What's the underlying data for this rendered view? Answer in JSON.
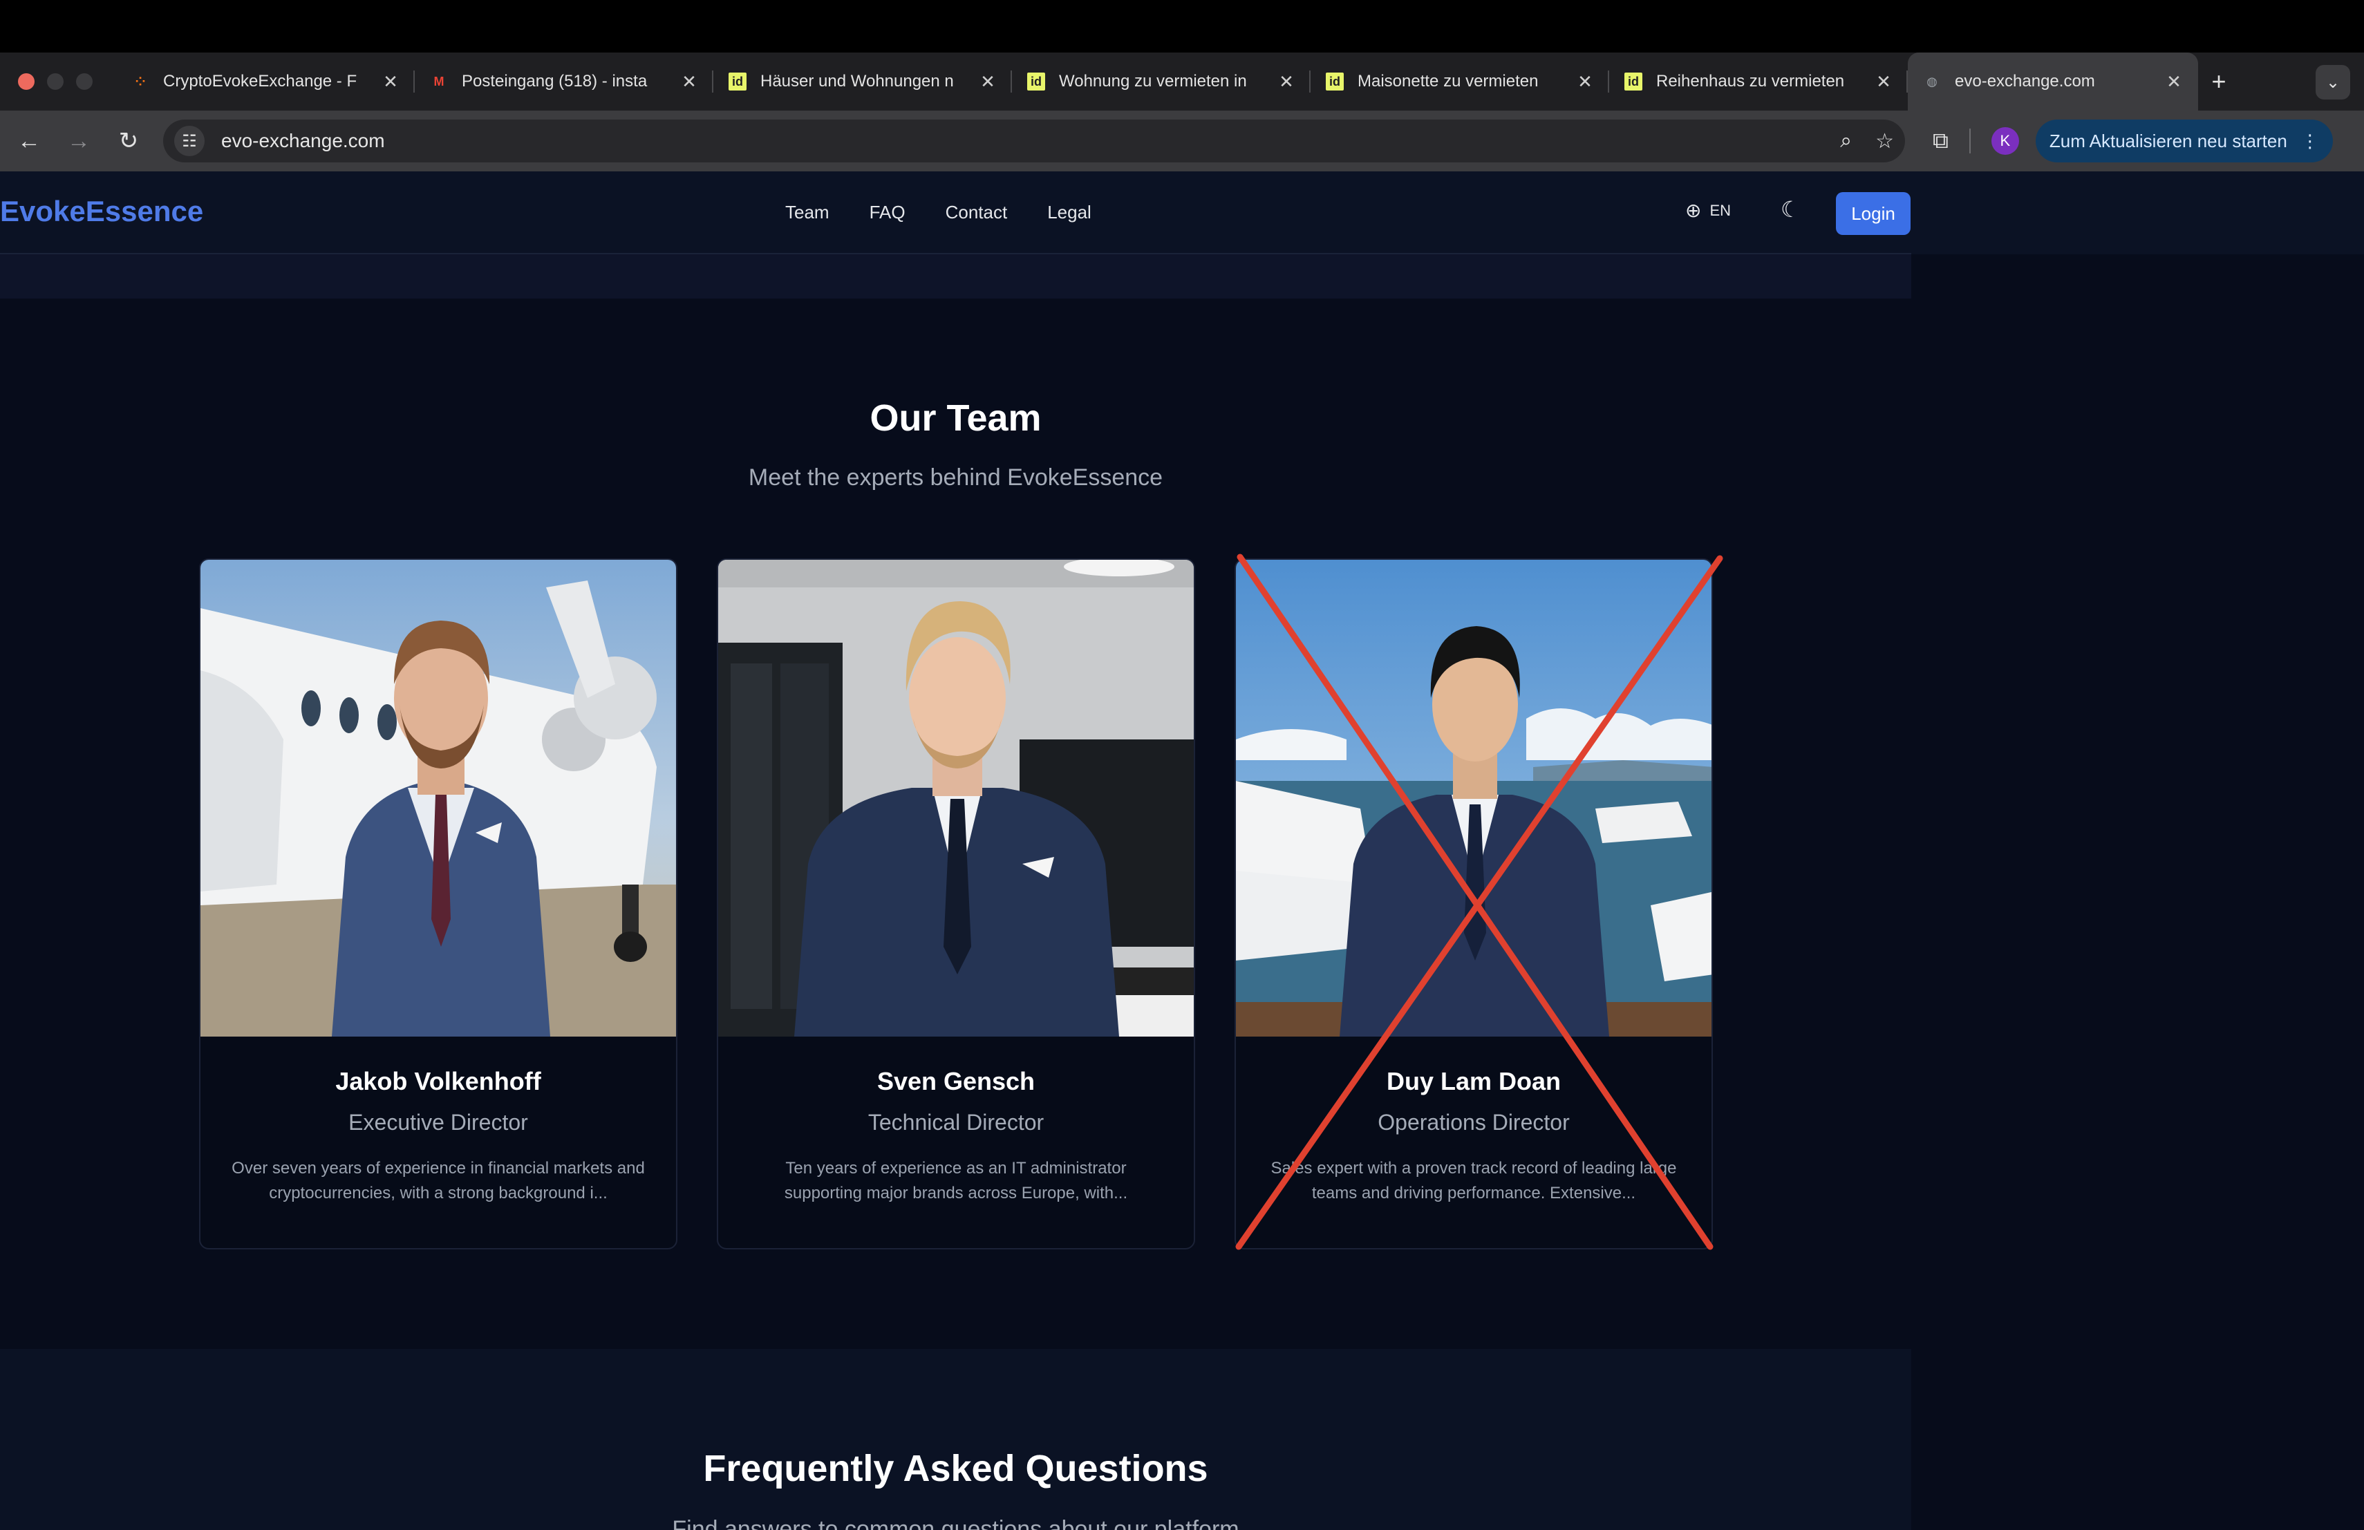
{
  "browser": {
    "tabs": [
      {
        "favicon": "crypto-evoke-icon",
        "title": "CryptoEvokeExchange - F"
      },
      {
        "favicon": "gmail-icon",
        "title": "Posteingang (518) - insta"
      },
      {
        "favicon": "immo-id-icon",
        "title": "Häuser und Wohnungen n"
      },
      {
        "favicon": "immo-id-icon",
        "title": "Wohnung zu vermieten in"
      },
      {
        "favicon": "immo-id-icon",
        "title": "Maisonette zu vermieten"
      },
      {
        "favicon": "immo-id-icon",
        "title": "Reihenhaus zu vermieten"
      },
      {
        "favicon": "globe-icon",
        "title": "evo-exchange.com"
      }
    ],
    "url": "evo-exchange.com",
    "profile_initial": "K",
    "update_button": "Zum Aktualisieren neu starten"
  },
  "site": {
    "brand": "EvokeEssence",
    "nav": [
      "Team",
      "FAQ",
      "Contact",
      "Legal"
    ],
    "lang": "EN",
    "login": "Login",
    "accent": "#3b6fe6"
  },
  "team": {
    "title": "Our Team",
    "subtitle": "Meet the experts behind EvokeEssence",
    "members": [
      {
        "name": "Jakob Volkenhoff",
        "role": "Executive Director",
        "bio": "Over seven years of experience in financial markets and cryptocurrencies, with a strong background i..."
      },
      {
        "name": "Sven Gensch",
        "role": "Technical Director",
        "bio": "Ten years of experience as an IT administrator supporting major brands across Europe, with..."
      },
      {
        "name": "Duy Lam Doan",
        "role": "Operations Director",
        "bio": "Sales expert with a proven track record of leading large teams and driving performance. Extensive..."
      }
    ],
    "crossed_out_member": "Duy Lam Doan"
  },
  "faq": {
    "title": "Frequently Asked Questions",
    "subtitle": "Find answers to common questions about our platform"
  }
}
